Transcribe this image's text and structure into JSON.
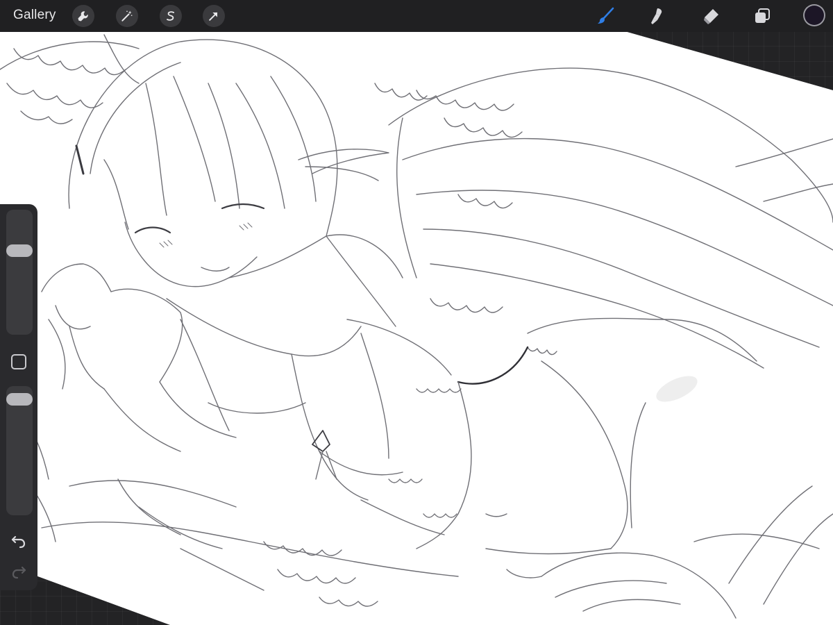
{
  "toolbar": {
    "gallery_label": "Gallery",
    "left_tools": [
      "wrench-icon",
      "magic-wand-icon",
      "selection-icon",
      "transform-arrow-icon"
    ],
    "right_tools": [
      "brush-icon",
      "smudge-icon",
      "eraser-icon",
      "layers-icon"
    ],
    "active_tool": "brush-icon",
    "active_color": "#2f7ee6",
    "current_color": "#1c1626"
  },
  "sidebar": {
    "brush_size_level": 0.72,
    "opacity_level": 1.0,
    "icons": [
      "modify-square-icon",
      "undo-icon",
      "redo-icon"
    ]
  },
  "canvas": {
    "background": "#ffffff",
    "stroke_color": "#6e6e74"
  }
}
